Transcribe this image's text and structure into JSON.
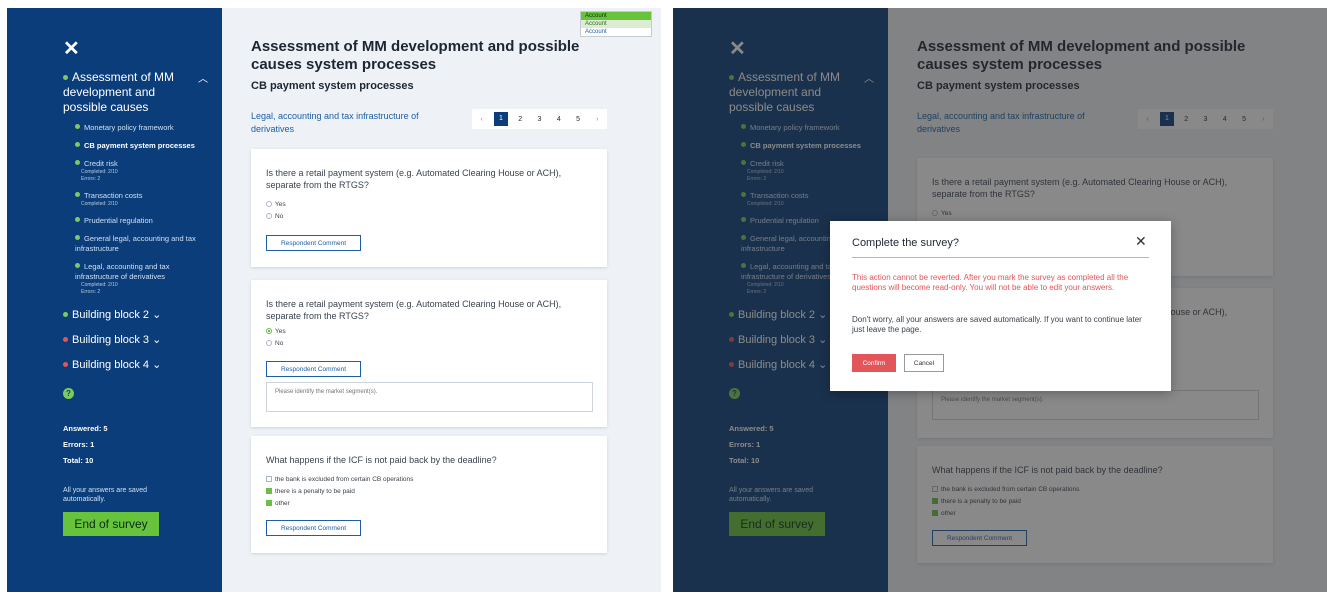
{
  "survey": {
    "title": "Assessment of MM development and possible causes system processes",
    "subtitle": "CB payment system processes",
    "section": "Legal, accounting and tax infrastructure of derivatives",
    "pages": [
      "1",
      "2",
      "3",
      "4",
      "5"
    ],
    "current_page": "1",
    "prev_arrow": "‹",
    "next_arrow": "›"
  },
  "sidebar": {
    "close": "✕",
    "main_item": "Assessment of MM development and possible causes",
    "items": [
      {
        "label": "Monetary policy framework"
      },
      {
        "label": "CB payment system processes"
      },
      {
        "label": "Credit risk",
        "completed": "Completed: 2/10",
        "errors": "Errors: 2"
      },
      {
        "label": "Transaction costs",
        "completed": "Completed: 2/10"
      },
      {
        "label": "Prudential regulation"
      },
      {
        "label": "General legal, accounting and tax infrastructure"
      },
      {
        "label": "Legal, accounting and tax infrastructure of derivatives",
        "completed": "Completed: 2/10",
        "errors": "Errors: 2"
      }
    ],
    "blocks": [
      {
        "label": "Building block 2",
        "status_color": "#7fc95e"
      },
      {
        "label": "Building block 3",
        "status_color": "#e2555a"
      },
      {
        "label": "Building block 4",
        "status_color": "#e2555a"
      }
    ],
    "help": "?",
    "answered": "Answered: 5",
    "errors": "Errors: 1",
    "total": "Total: 10",
    "saved_note": "All your answers are saved automatically.",
    "end_button": "End of survey"
  },
  "questions": [
    {
      "text": "Is there a retail payment system (e.g. Automated Clearing House or ACH), separate from the RTGS?",
      "options": [
        "Yes",
        "No"
      ]
    },
    {
      "text": "Is there a retail payment system (e.g. Automated Clearing House or ACH), separate from the RTGS?",
      "options": [
        "Yes",
        "No"
      ],
      "selected": "Yes",
      "placeholder": "Please identify the market segment(s)."
    },
    {
      "text": "What happens if the ICF is not paid back by the deadline?",
      "options": [
        "the bank is excluded from certain CB operations",
        "there is a penalty to be paid",
        "other"
      ]
    }
  ],
  "respondent_comment": "Respondent Comment",
  "account_menu": [
    "Account",
    "Account",
    "Account"
  ],
  "modal": {
    "title": "Complete the survey?",
    "close": "✕",
    "warning": "This action cannot be reverted. After you mark the survey as completed all the questions will become read-only. You will not be able to edit your answers.",
    "info": "Don't worry, all your answers are saved automatically. If you want to continue later just leave the page.",
    "confirm": "Confirm",
    "cancel": "Cancel"
  },
  "colors": {
    "sidebar": "#0b3d7a",
    "accent_green": "#66c33b",
    "error_red": "#e2555a",
    "link_blue": "#1c5ea8"
  }
}
